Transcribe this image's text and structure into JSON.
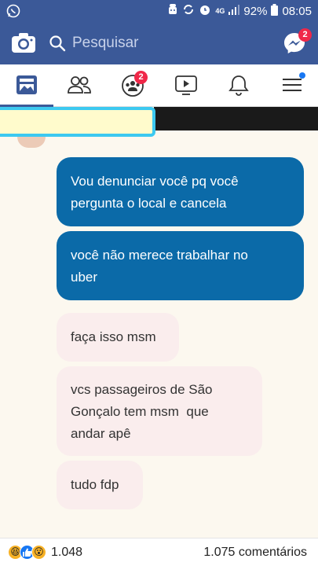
{
  "status_bar": {
    "network": "4G",
    "battery": "92%",
    "time": "08:05"
  },
  "header": {
    "search_placeholder": "Pesquisar",
    "messenger_badge": "2"
  },
  "tabs": {
    "groups_badge": "2"
  },
  "messages": [
    {
      "direction": "outgoing",
      "text_line1": "Vou denunciar você pq você",
      "text_line2": "pergunta o local e cancela"
    },
    {
      "direction": "outgoing",
      "text_line1": "você não merece trabalhar no",
      "text_line2": "uber"
    },
    {
      "direction": "incoming",
      "text_line1": "faça isso msm"
    },
    {
      "direction": "incoming",
      "text_line1": "vcs passageiros de São",
      "text_line2": "Gonçalo tem msm  que",
      "text_line3": "andar apê"
    },
    {
      "direction": "incoming",
      "text_line1": "tudo fdp"
    }
  ],
  "footer": {
    "reaction_count": "1.048",
    "comments": "1.075 comentários"
  },
  "colors": {
    "facebook_blue": "#3b5998",
    "outgoing_bubble": "#0b6aa8",
    "incoming_bubble": "#faeded",
    "badge": "#f02849"
  }
}
